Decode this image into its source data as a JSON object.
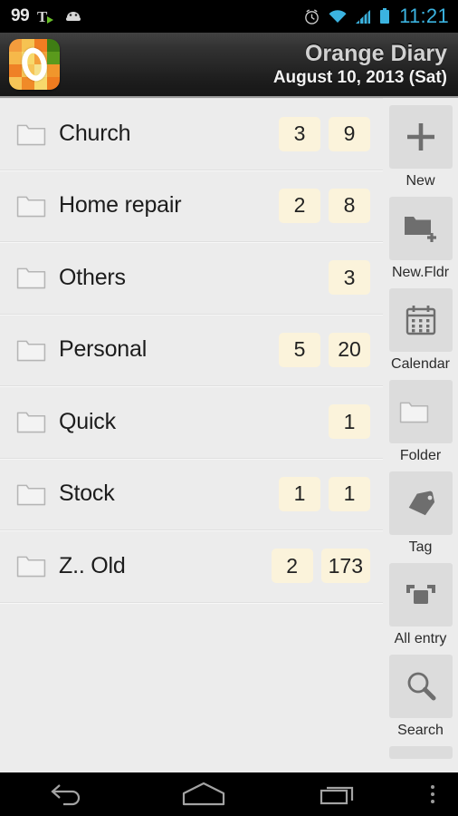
{
  "status_bar": {
    "notification_count": "99",
    "time": "11:21",
    "icons": [
      "tts-icon",
      "android-head-icon",
      "alarm-clock-icon",
      "wifi-icon",
      "signal-icon",
      "battery-icon"
    ],
    "time_color": "#3bb3e0"
  },
  "header": {
    "app_logo": "orange-diary-logo",
    "title": "Orange Diary",
    "subtitle": "August 10, 2013 (Sat)"
  },
  "folder_list": [
    {
      "icon": "folder-icon",
      "name": "Church",
      "badges": [
        "3",
        "9"
      ]
    },
    {
      "icon": "folder-icon",
      "name": "Home repair",
      "badges": [
        "2",
        "8"
      ]
    },
    {
      "icon": "folder-icon",
      "name": "Others",
      "badges": [
        "3"
      ]
    },
    {
      "icon": "folder-icon",
      "name": "Personal",
      "badges": [
        "5",
        "20"
      ]
    },
    {
      "icon": "folder-icon",
      "name": "Quick",
      "badges": [
        "1"
      ]
    },
    {
      "icon": "folder-icon",
      "name": "Stock",
      "badges": [
        "1",
        "1"
      ]
    },
    {
      "icon": "folder-icon",
      "name": "Z.. Old",
      "badges": [
        "2",
        "173"
      ]
    }
  ],
  "sidebar": [
    {
      "icon": "plus-icon",
      "label": "New"
    },
    {
      "icon": "folder-plus-icon",
      "label": "New.Fldr"
    },
    {
      "icon": "calendar-icon",
      "label": "Calendar"
    },
    {
      "icon": "folder-icon",
      "label": "Folder"
    },
    {
      "icon": "tag-icon",
      "label": "Tag"
    },
    {
      "icon": "all-entry-icon",
      "label": "All entry"
    },
    {
      "icon": "search-icon",
      "label": "Search"
    }
  ],
  "nav_bar": {
    "back": "back-icon",
    "home": "home-icon",
    "recents": "recents-icon",
    "overflow": "overflow-menu-icon"
  },
  "colors": {
    "badge_bg": "#fbf3db",
    "list_bg": "#ececec",
    "tile_bg": "#dcdcdc",
    "accent": "#f08a1e"
  }
}
